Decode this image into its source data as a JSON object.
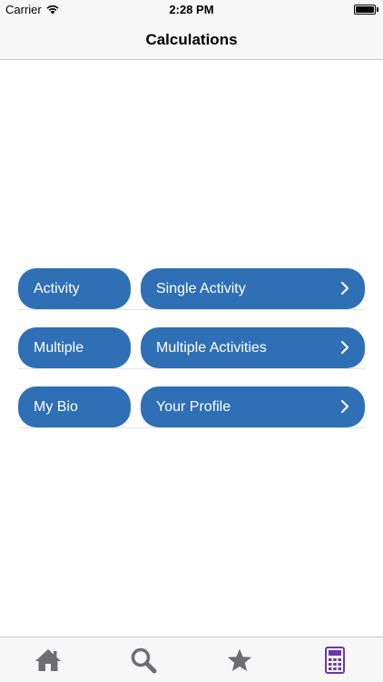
{
  "status": {
    "carrier": "Carrier",
    "time": "2:28 PM"
  },
  "nav": {
    "title": "Calculations"
  },
  "rows": [
    {
      "left": "Activity",
      "right": "Single Activity"
    },
    {
      "left": "Multiple",
      "right": "Multiple Activities"
    },
    {
      "left": "My Bio",
      "right": "Your Profile"
    }
  ],
  "tabs": [
    {
      "icon": "home-icon"
    },
    {
      "icon": "search-icon"
    },
    {
      "icon": "star-icon"
    },
    {
      "icon": "calculator-icon",
      "active": true
    }
  ],
  "colors": {
    "pill": "#2f6fb5",
    "tab_inactive": "#6d6d72",
    "tab_active": "#6a3aa8"
  }
}
